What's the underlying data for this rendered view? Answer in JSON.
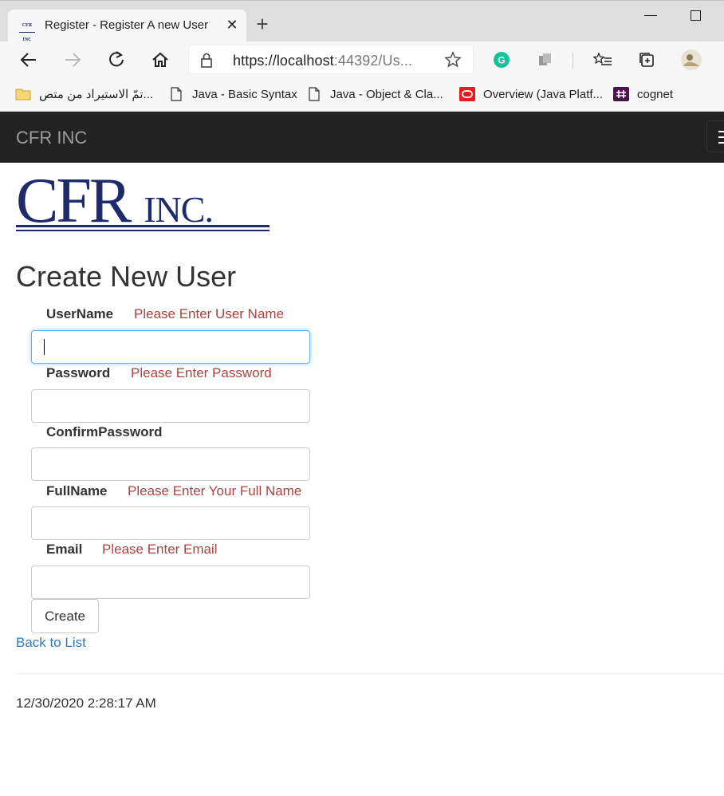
{
  "browser": {
    "tab_title": "Register - Register A new User",
    "favicon_text": "CFR INC",
    "address_host": "https://localhost",
    "address_rest": ":44392/Us...",
    "bookmarks": [
      {
        "label": "تمّ الاستيراد من متص...",
        "icon": "folder-icon"
      },
      {
        "label": "Java - Basic Syntax",
        "icon": "page-icon"
      },
      {
        "label": "Java - Object & Cla...",
        "icon": "page-icon"
      },
      {
        "label": "Overview (Java Platf...",
        "icon": "oracle-icon"
      },
      {
        "label": "cognet",
        "icon": "slack-icon"
      }
    ]
  },
  "navbar": {
    "brand": "CFR INC"
  },
  "logo": {
    "primary": "CFR",
    "secondary": "INC."
  },
  "page": {
    "title": "Create New User"
  },
  "form": {
    "username": {
      "label": "UserName",
      "error": "Please Enter User Name",
      "value": ""
    },
    "password": {
      "label": "Password",
      "error": "Please Enter Password",
      "value": ""
    },
    "confirm_password": {
      "label": "ConfirmPassword",
      "error": "",
      "value": ""
    },
    "full_name": {
      "label": "FullName",
      "error": "Please Enter Your Full Name",
      "value": ""
    },
    "email": {
      "label": "Email",
      "error": "Please Enter Email",
      "value": ""
    },
    "submit_label": "Create"
  },
  "back_link": "Back to List",
  "footer": {
    "timestamp": "12/30/2020 2:28:17 AM"
  },
  "colors": {
    "navbar_bg": "#222222",
    "brand_text": "#9d9d9d",
    "error_text": "#a94442",
    "link": "#337ab7",
    "logo_navy": "#1d2b6b"
  }
}
